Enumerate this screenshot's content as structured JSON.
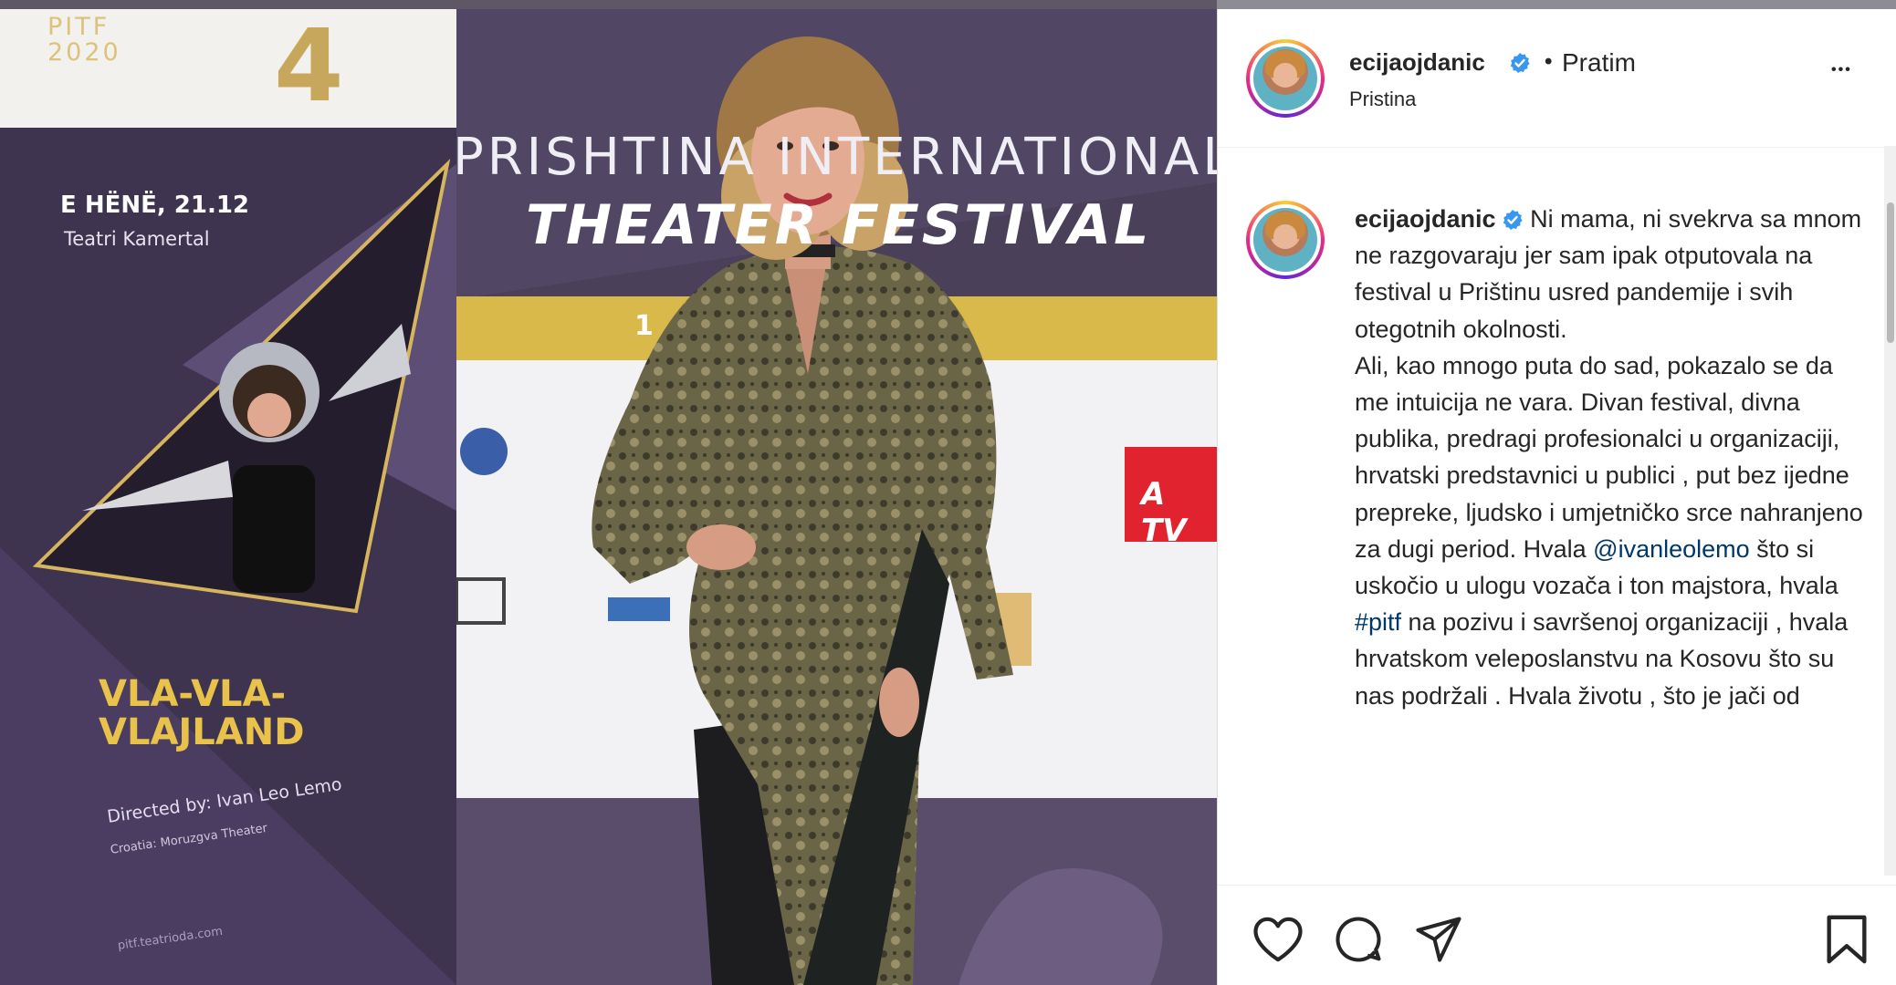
{
  "photo": {
    "left_banner": {
      "festival_tag": "PITF 2020",
      "number": "4",
      "date": "E HËNË, 21.12",
      "venue": "Teatri Kamertal",
      "title_line1": "VLA-VLA-",
      "title_line2": "VLAJLAND",
      "directed_by": "Directed by: Ivan Leo Lemo",
      "company": "Croatia: Moruzgva Theater",
      "website": "pitf.teatrioda.com"
    },
    "backdrop": {
      "line1": "PRISHTINA INTERNATIONAL",
      "line2": "THEATER FESTIVAL",
      "tv_logo": "A TV",
      "gold_strip": "1"
    }
  },
  "post": {
    "header": {
      "username": "ecijaojdanic",
      "follow_separator": "•",
      "follow_label": "Pratim",
      "location": "Pristina",
      "more_label": "•••"
    },
    "caption": {
      "username": "ecijaojdanic",
      "text_part1": " Ni mama, ni svekrva sa mnom ne razgovaraju jer sam ipak otputovala na festival u Prištinu usred pandemije i svih otegotnih okolnosti.",
      "text_part2": "Ali, kao mnogo puta do sad, pokazalo se da me intuicija ne vara. Divan festival, divna publika, predragi profesionalci u organizaciji, hrvatski predstavnici u publici , put bez ijedne prepreke, ljudsko i umjetničko srce nahranjeno za dugi period. Hvala ",
      "mention": "@ivanleolemo",
      "text_part3": " što si uskočio u ulogu vozača i ton majstora, hvala ",
      "hashtag": "#pitf",
      "text_part4": " na pozivu i savršenoj organizaciji , hvala hrvatskom veleposlanstvu na Kosovu što su nas podržali . Hvala životu , što je jači od"
    },
    "actions": {
      "like": "heart-icon",
      "comment": "comment-icon",
      "share": "share-icon",
      "save": "bookmark-icon"
    }
  },
  "colors": {
    "verified_blue": "#3897f0",
    "link_blue": "#00376b",
    "text": "#262626",
    "banner_purple": "#4a3d62",
    "gold": "#e8c24a"
  }
}
